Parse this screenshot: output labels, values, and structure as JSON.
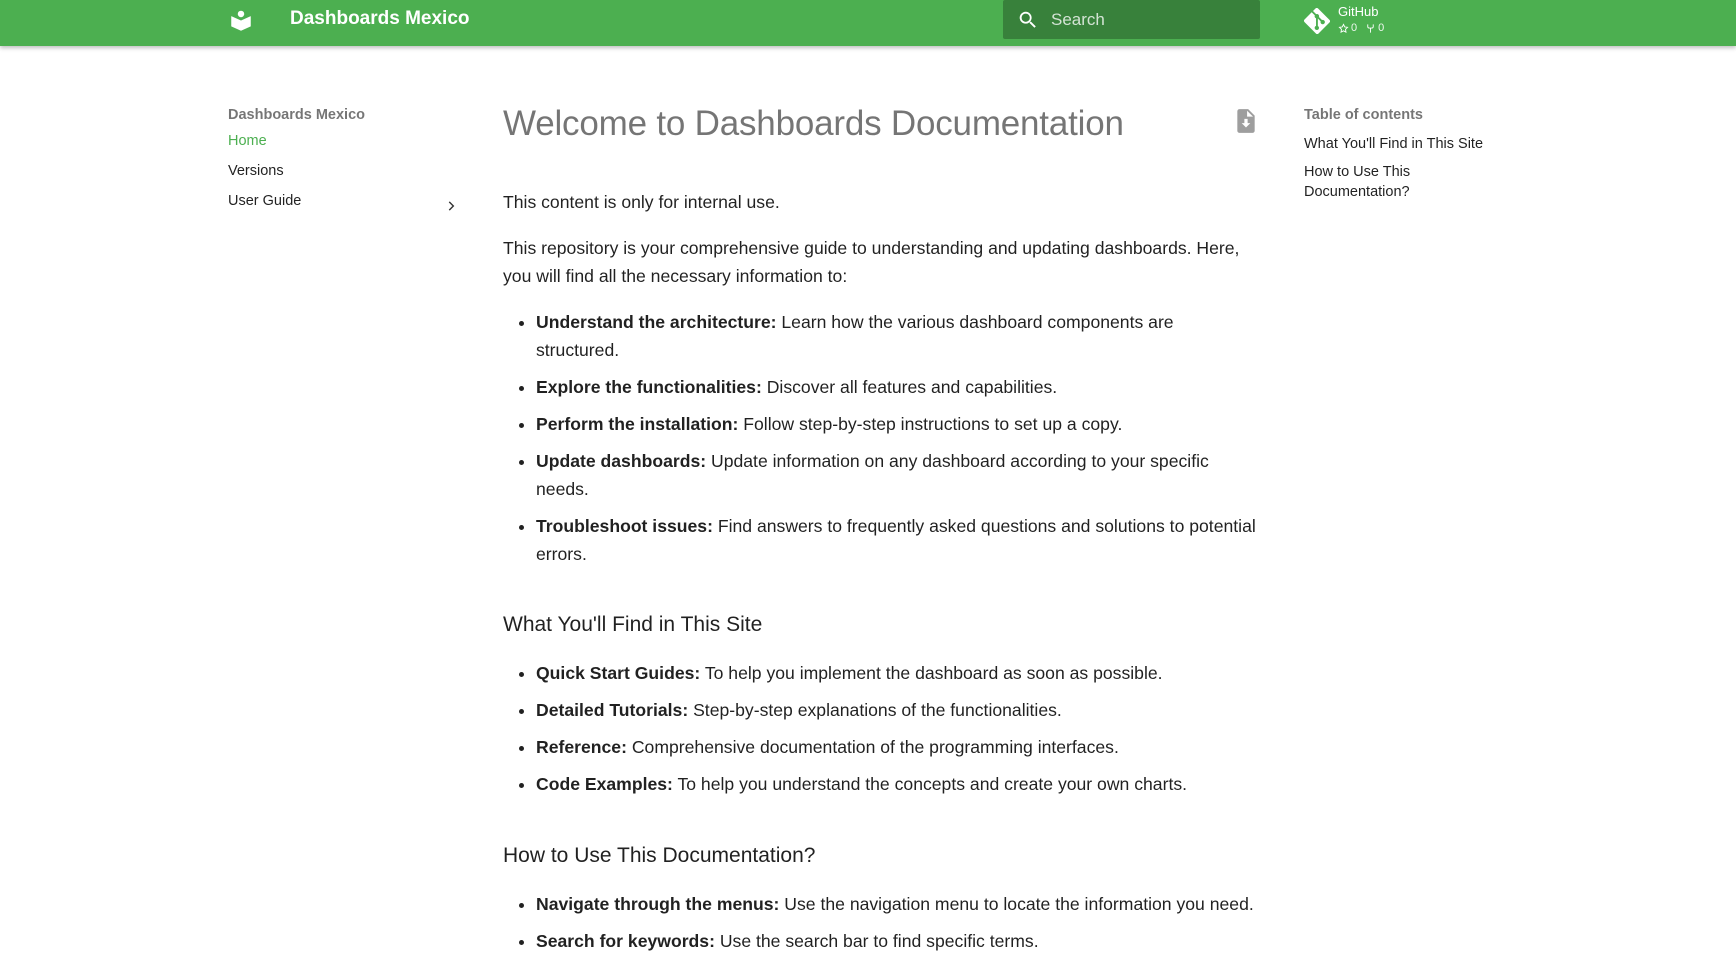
{
  "header": {
    "site_title": "Dashboards Mexico",
    "logo_icon": "book-icon",
    "search_placeholder": "Search",
    "repo": {
      "name": "GitHub",
      "stars": "0",
      "forks": "0"
    }
  },
  "nav": {
    "title": "Dashboards Mexico",
    "items": [
      {
        "label": "Home",
        "active": true
      },
      {
        "label": "Versions",
        "active": false
      },
      {
        "label": "User Guide",
        "active": false,
        "has_children": true
      }
    ]
  },
  "content": {
    "title": "Welcome to Dashboards Documentation",
    "intro1": "This content is only for internal use.",
    "intro2": "This repository is your comprehensive guide to understanding and updating dashboards. Here, you will find all the necessary information to:",
    "list1": [
      {
        "term": "Understand the architecture:",
        "text": " Learn how the various dashboard components are structured."
      },
      {
        "term": "Explore the functionalities:",
        "text": " Discover all features and capabilities."
      },
      {
        "term": "Perform the installation:",
        "text": " Follow step-by-step instructions to set up a copy."
      },
      {
        "term": "Update dashboards:",
        "text": " Update information on any dashboard according to your specific needs."
      },
      {
        "term": "Troubleshoot issues:",
        "text": " Find answers to frequently asked questions and solutions to potential errors."
      }
    ],
    "section1": {
      "heading": "What You'll Find in This Site",
      "items": [
        {
          "term": "Quick Start Guides:",
          "text": " To help you implement the dashboard as soon as possible."
        },
        {
          "term": "Detailed Tutorials:",
          "text": " Step-by-step explanations of the functionalities."
        },
        {
          "term": "Reference:",
          "text": " Comprehensive documentation of the programming interfaces."
        },
        {
          "term": "Code Examples:",
          "text": " To help you understand the concepts and create your own charts."
        }
      ]
    },
    "section2": {
      "heading": "How to Use This Documentation?",
      "items": [
        {
          "term": "Navigate through the menus:",
          "text": " Use the navigation menu to locate the information you need."
        },
        {
          "term": "Search for keywords:",
          "text": " Use the search bar to find specific terms."
        }
      ]
    }
  },
  "toc": {
    "title": "Table of contents",
    "items": [
      "What You'll Find in This Site",
      "How to Use This Documentation?"
    ]
  },
  "colors": {
    "primary": "#4caf50",
    "text": "#212121",
    "muted": "#757575"
  }
}
